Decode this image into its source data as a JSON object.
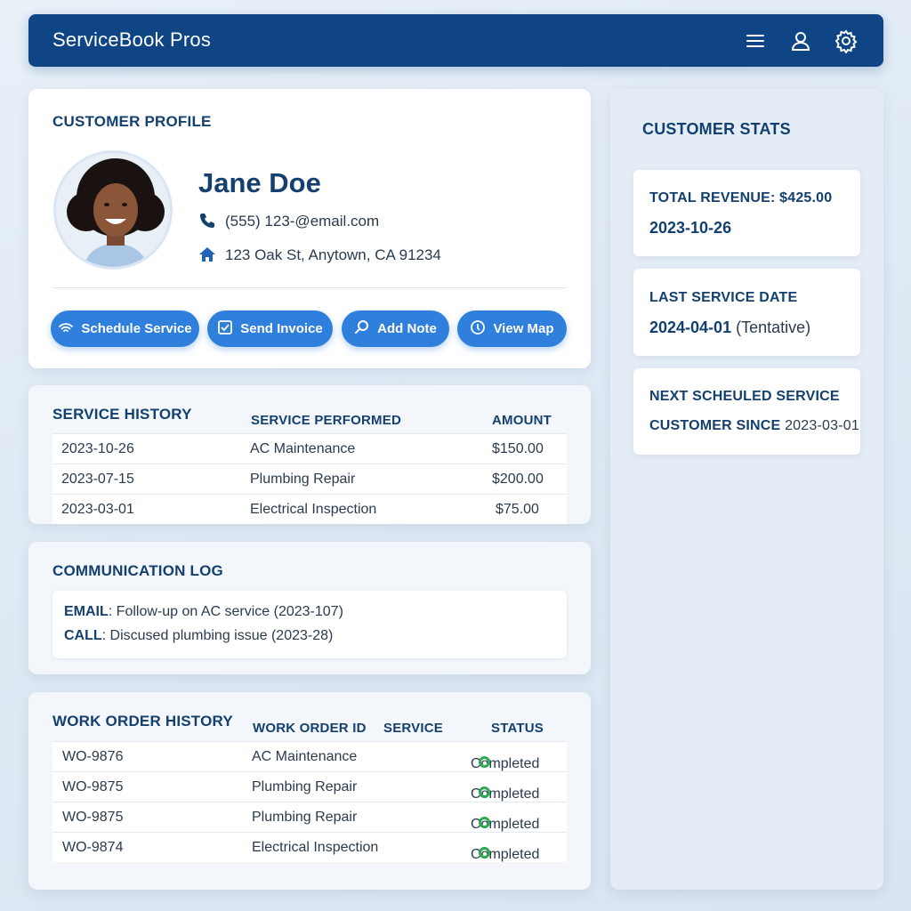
{
  "app": {
    "title": "ServiceBook Pros"
  },
  "topbar_icons": [
    "menu-icon",
    "user-icon",
    "gear-icon"
  ],
  "profile": {
    "section_title": "CUSTOMER PROFILE",
    "name": "Jane Doe",
    "phone": "(555) 123-@email.com",
    "address": "123 Oak St, Anytown, CA 91234",
    "actions": [
      {
        "label": "Schedule Service",
        "icon": "wifi-icon"
      },
      {
        "label": "Send Invoice",
        "icon": "check-square-icon"
      },
      {
        "label": "Add Note",
        "icon": "search-icon"
      },
      {
        "label": "View Map",
        "icon": "compass-icon"
      }
    ]
  },
  "service_history": {
    "section_title": "SERVICE HISTORY",
    "columns": [
      "SERVICE PERFORMED",
      "AMOUNT"
    ],
    "rows": [
      {
        "date": "2023-10-26",
        "service": "AC Maintenance",
        "amount": "$150.00"
      },
      {
        "date": "2023-07-15",
        "service": "Plumbing Repair",
        "amount": "$200.00"
      },
      {
        "date": "2023-03-01",
        "service": "Electrical Inspection",
        "amount": "$75.00"
      }
    ]
  },
  "communication_log": {
    "section_title": "COMMUNICATION LOG",
    "entries": [
      {
        "type": "EMAIL",
        "text": ": Follow-up on AC service (2023-107)"
      },
      {
        "type": "CALL",
        "text": ": Discused plumbing issue (2023-28)"
      }
    ]
  },
  "work_orders": {
    "section_title": "WORK ORDER HISTORY",
    "columns": [
      "WORK ORDER ID",
      "SERVICE",
      "STATUS"
    ],
    "rows": [
      {
        "id": "WO-9876",
        "service": "AC Maintenance",
        "status": "Completed"
      },
      {
        "id": "WO-9875",
        "service": "Plumbing Repair",
        "status": "Completed"
      },
      {
        "id": "WO-9875",
        "service": "Plumbing Repair",
        "status": "Completed"
      },
      {
        "id": "WO-9874",
        "service": "Electrical Inspection",
        "status": "Completed"
      }
    ]
  },
  "stats": {
    "section_title": "CUSTOMER STATS",
    "revenue_label": "TOTAL REVENUE: $425.00",
    "revenue_date": "2023-10-26",
    "last_service_label": "LAST SERVICE DATE",
    "last_service_date": "2024-04-01",
    "last_service_note": "(Tentative)",
    "next_service_label": "NEXT SCHEULED SERVICE",
    "customer_since_label": "CUSTOMER SINCE",
    "customer_since_date": "2023-03-01"
  },
  "colors": {
    "primary": "#0f4585",
    "accent": "#2f7fdc",
    "success": "#2eaa4f"
  }
}
